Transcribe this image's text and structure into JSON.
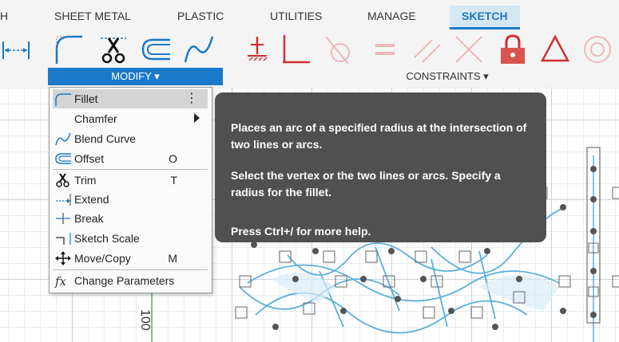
{
  "tabs": [
    {
      "label": "H"
    },
    {
      "label": "SHEET METAL"
    },
    {
      "label": "PLASTIC"
    },
    {
      "label": "UTILITIES"
    },
    {
      "label": "MANAGE"
    },
    {
      "label": "SKETCH",
      "active": true
    }
  ],
  "groups": {
    "modify": {
      "label": "MODIFY ▾"
    },
    "constraints": {
      "label": "CONSTRAINTS ▾"
    }
  },
  "toolbar_icons": [
    "dimension-icon",
    "fillet-icon",
    "trim-icon",
    "offset-icon",
    "blend-curve-icon",
    "fix-unfix-icon",
    "perpendicular-icon",
    "tangent-icon",
    "equal-icon",
    "parallel-icon",
    "collinear-icon",
    "lock-icon",
    "triangle-icon",
    "concentric-icon"
  ],
  "menu": {
    "items": [
      {
        "label": "Fillet",
        "shortcut": "",
        "icon": "fillet-icon",
        "more": "⋮",
        "highlighted": true
      },
      {
        "label": "Chamfer",
        "shortcut": "",
        "icon": "chamfer-icon",
        "submenu": true
      },
      {
        "label": "Blend Curve",
        "shortcut": "",
        "icon": "blend-curve-icon"
      },
      {
        "label": "Offset",
        "shortcut": "O",
        "icon": "offset-icon"
      },
      {
        "label": "Trim",
        "shortcut": "T",
        "icon": "trim-icon"
      },
      {
        "label": "Extend",
        "shortcut": "",
        "icon": "extend-icon"
      },
      {
        "label": "Break",
        "shortcut": "",
        "icon": "break-icon"
      },
      {
        "label": "Sketch Scale",
        "shortcut": "",
        "icon": "sketch-scale-icon"
      },
      {
        "label": "Move/Copy",
        "shortcut": "M",
        "icon": "move-icon"
      },
      {
        "label": "Change Parameters",
        "shortcut": "",
        "icon": "fx-icon"
      }
    ]
  },
  "tooltip": {
    "line1": "Places an arc of a specified radius at the intersection of two lines or arcs.",
    "line2": "Select the vertex or the two lines or arcs. Specify a radius for the fillet.",
    "line3": "Press Ctrl+/ for more help."
  },
  "canvas": {
    "axis_label": "100"
  },
  "colors": {
    "accent": "#1a79c9",
    "constraint_red": "#d32f2f",
    "sketch_blue": "#5aaedc",
    "tooltip_bg": "#505050"
  }
}
